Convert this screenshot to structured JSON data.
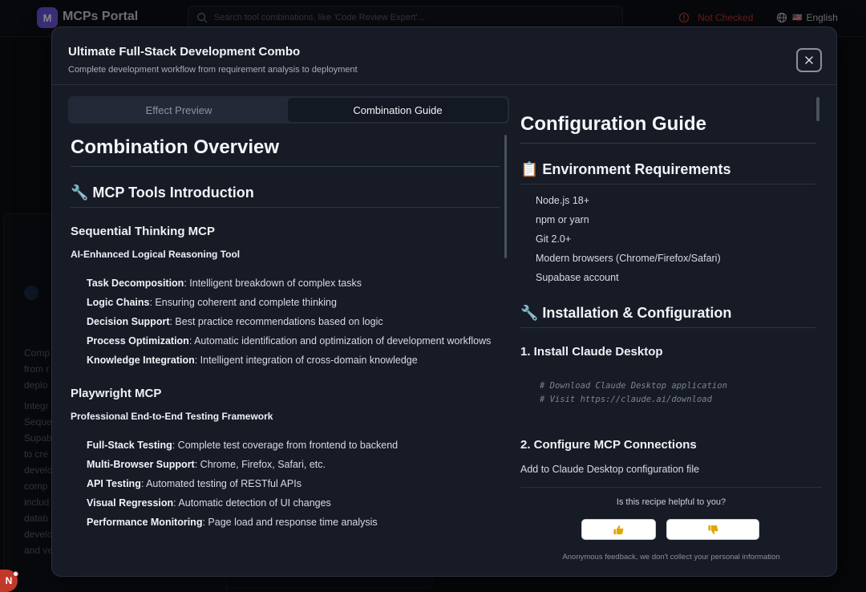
{
  "app": {
    "logo_letter": "M",
    "name": "MCPs Portal"
  },
  "header": {
    "search_placeholder": "Search tool combinations, like 'Code Review Expert'...",
    "status_text": "Not Checked",
    "language_label": "English",
    "language_flag": "🇺🇸"
  },
  "background_card": {
    "text_lines": [
      "Comp",
      "from r",
      "deplo",
      "Integr",
      "Seque",
      "Supab",
      "to cre",
      "develo",
      "comp",
      "includ",
      "datab",
      "develo",
      "and ve"
    ]
  },
  "modal": {
    "title": "Ultimate Full-Stack Development Combo",
    "subtitle": "Complete development workflow from requirement analysis to deployment",
    "tabs": [
      {
        "label": "Effect Preview",
        "active": false
      },
      {
        "label": "Combination Guide",
        "active": true
      }
    ],
    "overview": {
      "heading": "Combination Overview",
      "section_heading": "🔧 MCP Tools Introduction",
      "tools": [
        {
          "name": "Sequential Thinking MCP",
          "subtitle": "AI-Enhanced Logical Reasoning Tool",
          "features": [
            {
              "title": "Task Decomposition",
              "desc": ": Intelligent breakdown of complex tasks"
            },
            {
              "title": "Logic Chains",
              "desc": ": Ensuring coherent and complete thinking"
            },
            {
              "title": "Decision Support",
              "desc": ": Best practice recommendations based on logic"
            },
            {
              "title": "Process Optimization",
              "desc": ": Automatic identification and optimization of development workflows"
            },
            {
              "title": "Knowledge Integration",
              "desc": ": Intelligent integration of cross-domain knowledge"
            }
          ]
        },
        {
          "name": "Playwright MCP",
          "subtitle": "Professional End-to-End Testing Framework",
          "features": [
            {
              "title": "Full-Stack Testing",
              "desc": ": Complete test coverage from frontend to backend"
            },
            {
              "title": "Multi-Browser Support",
              "desc": ": Chrome, Firefox, Safari, etc."
            },
            {
              "title": "API Testing",
              "desc": ": Automated testing of RESTful APIs"
            },
            {
              "title": "Visual Regression",
              "desc": ": Automatic detection of UI changes"
            },
            {
              "title": "Performance Monitoring",
              "desc": ": Page load and response time analysis"
            }
          ]
        }
      ]
    },
    "guide": {
      "heading": "Configuration Guide",
      "env_heading": "📋 Environment Requirements",
      "env_items": [
        "Node.js 18+",
        "npm or yarn",
        "Git 2.0+",
        "Modern browsers (Chrome/Firefox/Safari)",
        "Supabase account"
      ],
      "install_heading": "🔧 Installation & Configuration",
      "step1_heading": "1. Install Claude Desktop",
      "step1_code": [
        "# Download Claude Desktop application",
        "# Visit https://claude.ai/download"
      ],
      "step2_heading": "2. Configure MCP Connections",
      "step2_text": "Add to Claude Desktop configuration file"
    },
    "feedback": {
      "question": "Is this recipe helpful to you?",
      "note": "Anonymous feedback, we don't collect your personal information"
    }
  },
  "user": {
    "avatar_letter": "N"
  },
  "colors": {
    "accent": "#5a4fd8",
    "status_error": "#c0392b",
    "modal_bg": "#171b26",
    "thumb_icon": "#e0a800"
  }
}
